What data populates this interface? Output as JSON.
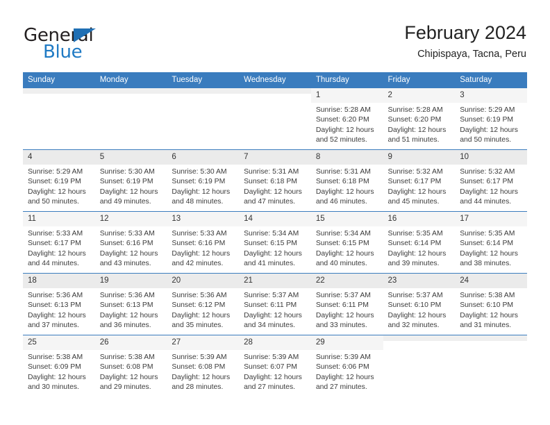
{
  "logo": {
    "word1": "General",
    "word2": "Blue",
    "triangle_color": "#1f6fb4",
    "blue_color": "#1f7ac4",
    "dark_color": "#231f20"
  },
  "header": {
    "title": "February 2024",
    "subtitle": "Chipispaya, Tacna, Peru"
  },
  "theme": {
    "header_row_bg": "#3a7cbe",
    "header_row_text": "#ffffff",
    "daynum_bg": "#f0f0f0",
    "cell_text": "#3b3b3b"
  },
  "weekdays": [
    "Sunday",
    "Monday",
    "Tuesday",
    "Wednesday",
    "Thursday",
    "Friday",
    "Saturday"
  ],
  "labels": {
    "sunrise": "Sunrise:",
    "sunset": "Sunset:",
    "daylight": "Daylight:"
  },
  "weeks": [
    [
      {
        "day": "",
        "empty": true
      },
      {
        "day": "",
        "empty": true
      },
      {
        "day": "",
        "empty": true
      },
      {
        "day": "",
        "empty": true
      },
      {
        "day": "1",
        "sunrise": "Sunrise: 5:28 AM",
        "sunset": "Sunset: 6:20 PM",
        "daylight": "Daylight: 12 hours and 52 minutes."
      },
      {
        "day": "2",
        "sunrise": "Sunrise: 5:28 AM",
        "sunset": "Sunset: 6:20 PM",
        "daylight": "Daylight: 12 hours and 51 minutes."
      },
      {
        "day": "3",
        "sunrise": "Sunrise: 5:29 AM",
        "sunset": "Sunset: 6:19 PM",
        "daylight": "Daylight: 12 hours and 50 minutes."
      }
    ],
    [
      {
        "day": "4",
        "sunrise": "Sunrise: 5:29 AM",
        "sunset": "Sunset: 6:19 PM",
        "daylight": "Daylight: 12 hours and 50 minutes."
      },
      {
        "day": "5",
        "sunrise": "Sunrise: 5:30 AM",
        "sunset": "Sunset: 6:19 PM",
        "daylight": "Daylight: 12 hours and 49 minutes."
      },
      {
        "day": "6",
        "sunrise": "Sunrise: 5:30 AM",
        "sunset": "Sunset: 6:19 PM",
        "daylight": "Daylight: 12 hours and 48 minutes."
      },
      {
        "day": "7",
        "sunrise": "Sunrise: 5:31 AM",
        "sunset": "Sunset: 6:18 PM",
        "daylight": "Daylight: 12 hours and 47 minutes."
      },
      {
        "day": "8",
        "sunrise": "Sunrise: 5:31 AM",
        "sunset": "Sunset: 6:18 PM",
        "daylight": "Daylight: 12 hours and 46 minutes."
      },
      {
        "day": "9",
        "sunrise": "Sunrise: 5:32 AM",
        "sunset": "Sunset: 6:17 PM",
        "daylight": "Daylight: 12 hours and 45 minutes."
      },
      {
        "day": "10",
        "sunrise": "Sunrise: 5:32 AM",
        "sunset": "Sunset: 6:17 PM",
        "daylight": "Daylight: 12 hours and 44 minutes."
      }
    ],
    [
      {
        "day": "11",
        "sunrise": "Sunrise: 5:33 AM",
        "sunset": "Sunset: 6:17 PM",
        "daylight": "Daylight: 12 hours and 44 minutes."
      },
      {
        "day": "12",
        "sunrise": "Sunrise: 5:33 AM",
        "sunset": "Sunset: 6:16 PM",
        "daylight": "Daylight: 12 hours and 43 minutes."
      },
      {
        "day": "13",
        "sunrise": "Sunrise: 5:33 AM",
        "sunset": "Sunset: 6:16 PM",
        "daylight": "Daylight: 12 hours and 42 minutes."
      },
      {
        "day": "14",
        "sunrise": "Sunrise: 5:34 AM",
        "sunset": "Sunset: 6:15 PM",
        "daylight": "Daylight: 12 hours and 41 minutes."
      },
      {
        "day": "15",
        "sunrise": "Sunrise: 5:34 AM",
        "sunset": "Sunset: 6:15 PM",
        "daylight": "Daylight: 12 hours and 40 minutes."
      },
      {
        "day": "16",
        "sunrise": "Sunrise: 5:35 AM",
        "sunset": "Sunset: 6:14 PM",
        "daylight": "Daylight: 12 hours and 39 minutes."
      },
      {
        "day": "17",
        "sunrise": "Sunrise: 5:35 AM",
        "sunset": "Sunset: 6:14 PM",
        "daylight": "Daylight: 12 hours and 38 minutes."
      }
    ],
    [
      {
        "day": "18",
        "sunrise": "Sunrise: 5:36 AM",
        "sunset": "Sunset: 6:13 PM",
        "daylight": "Daylight: 12 hours and 37 minutes."
      },
      {
        "day": "19",
        "sunrise": "Sunrise: 5:36 AM",
        "sunset": "Sunset: 6:13 PM",
        "daylight": "Daylight: 12 hours and 36 minutes."
      },
      {
        "day": "20",
        "sunrise": "Sunrise: 5:36 AM",
        "sunset": "Sunset: 6:12 PM",
        "daylight": "Daylight: 12 hours and 35 minutes."
      },
      {
        "day": "21",
        "sunrise": "Sunrise: 5:37 AM",
        "sunset": "Sunset: 6:11 PM",
        "daylight": "Daylight: 12 hours and 34 minutes."
      },
      {
        "day": "22",
        "sunrise": "Sunrise: 5:37 AM",
        "sunset": "Sunset: 6:11 PM",
        "daylight": "Daylight: 12 hours and 33 minutes."
      },
      {
        "day": "23",
        "sunrise": "Sunrise: 5:37 AM",
        "sunset": "Sunset: 6:10 PM",
        "daylight": "Daylight: 12 hours and 32 minutes."
      },
      {
        "day": "24",
        "sunrise": "Sunrise: 5:38 AM",
        "sunset": "Sunset: 6:10 PM",
        "daylight": "Daylight: 12 hours and 31 minutes."
      }
    ],
    [
      {
        "day": "25",
        "sunrise": "Sunrise: 5:38 AM",
        "sunset": "Sunset: 6:09 PM",
        "daylight": "Daylight: 12 hours and 30 minutes."
      },
      {
        "day": "26",
        "sunrise": "Sunrise: 5:38 AM",
        "sunset": "Sunset: 6:08 PM",
        "daylight": "Daylight: 12 hours and 29 minutes."
      },
      {
        "day": "27",
        "sunrise": "Sunrise: 5:39 AM",
        "sunset": "Sunset: 6:08 PM",
        "daylight": "Daylight: 12 hours and 28 minutes."
      },
      {
        "day": "28",
        "sunrise": "Sunrise: 5:39 AM",
        "sunset": "Sunset: 6:07 PM",
        "daylight": "Daylight: 12 hours and 27 minutes."
      },
      {
        "day": "29",
        "sunrise": "Sunrise: 5:39 AM",
        "sunset": "Sunset: 6:06 PM",
        "daylight": "Daylight: 12 hours and 27 minutes."
      },
      {
        "day": "",
        "empty": true
      },
      {
        "day": "",
        "empty": true
      }
    ]
  ]
}
